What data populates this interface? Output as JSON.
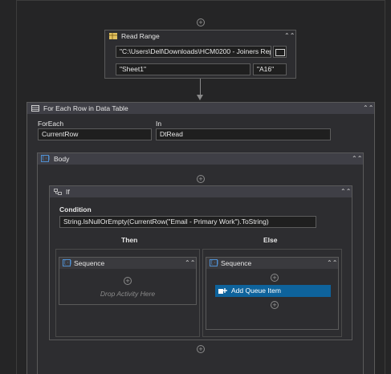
{
  "read_range": {
    "title": "Read Range",
    "path_value": "\"C:\\Users\\Dell\\Downloads\\HCM0200 - Joiners Rep",
    "sheet_value": "\"Sheet1\"",
    "range_value": "\"A16\""
  },
  "for_each": {
    "title": "For Each Row in Data Table",
    "foreach_label": "ForEach",
    "foreach_value": "CurrentRow",
    "in_label": "In",
    "in_value": "DtRead"
  },
  "body": {
    "title": "Body"
  },
  "if": {
    "title": "If",
    "condition_label": "Condition",
    "condition_value": "String.IsNullOrEmpty(CurrentRow(\"Email - Primary Work\").ToString)",
    "then_label": "Then",
    "else_label": "Else"
  },
  "then_sequence": {
    "title": "Sequence",
    "placeholder": "Drop Activity Here"
  },
  "else_sequence": {
    "title": "Sequence",
    "activity_title": "Add Queue Item"
  },
  "icons": {
    "plus": "+",
    "collapse": "⌃⌃"
  },
  "colors": {
    "background": "#252526",
    "header": "#3f3f46",
    "selected": "#0e639c"
  }
}
